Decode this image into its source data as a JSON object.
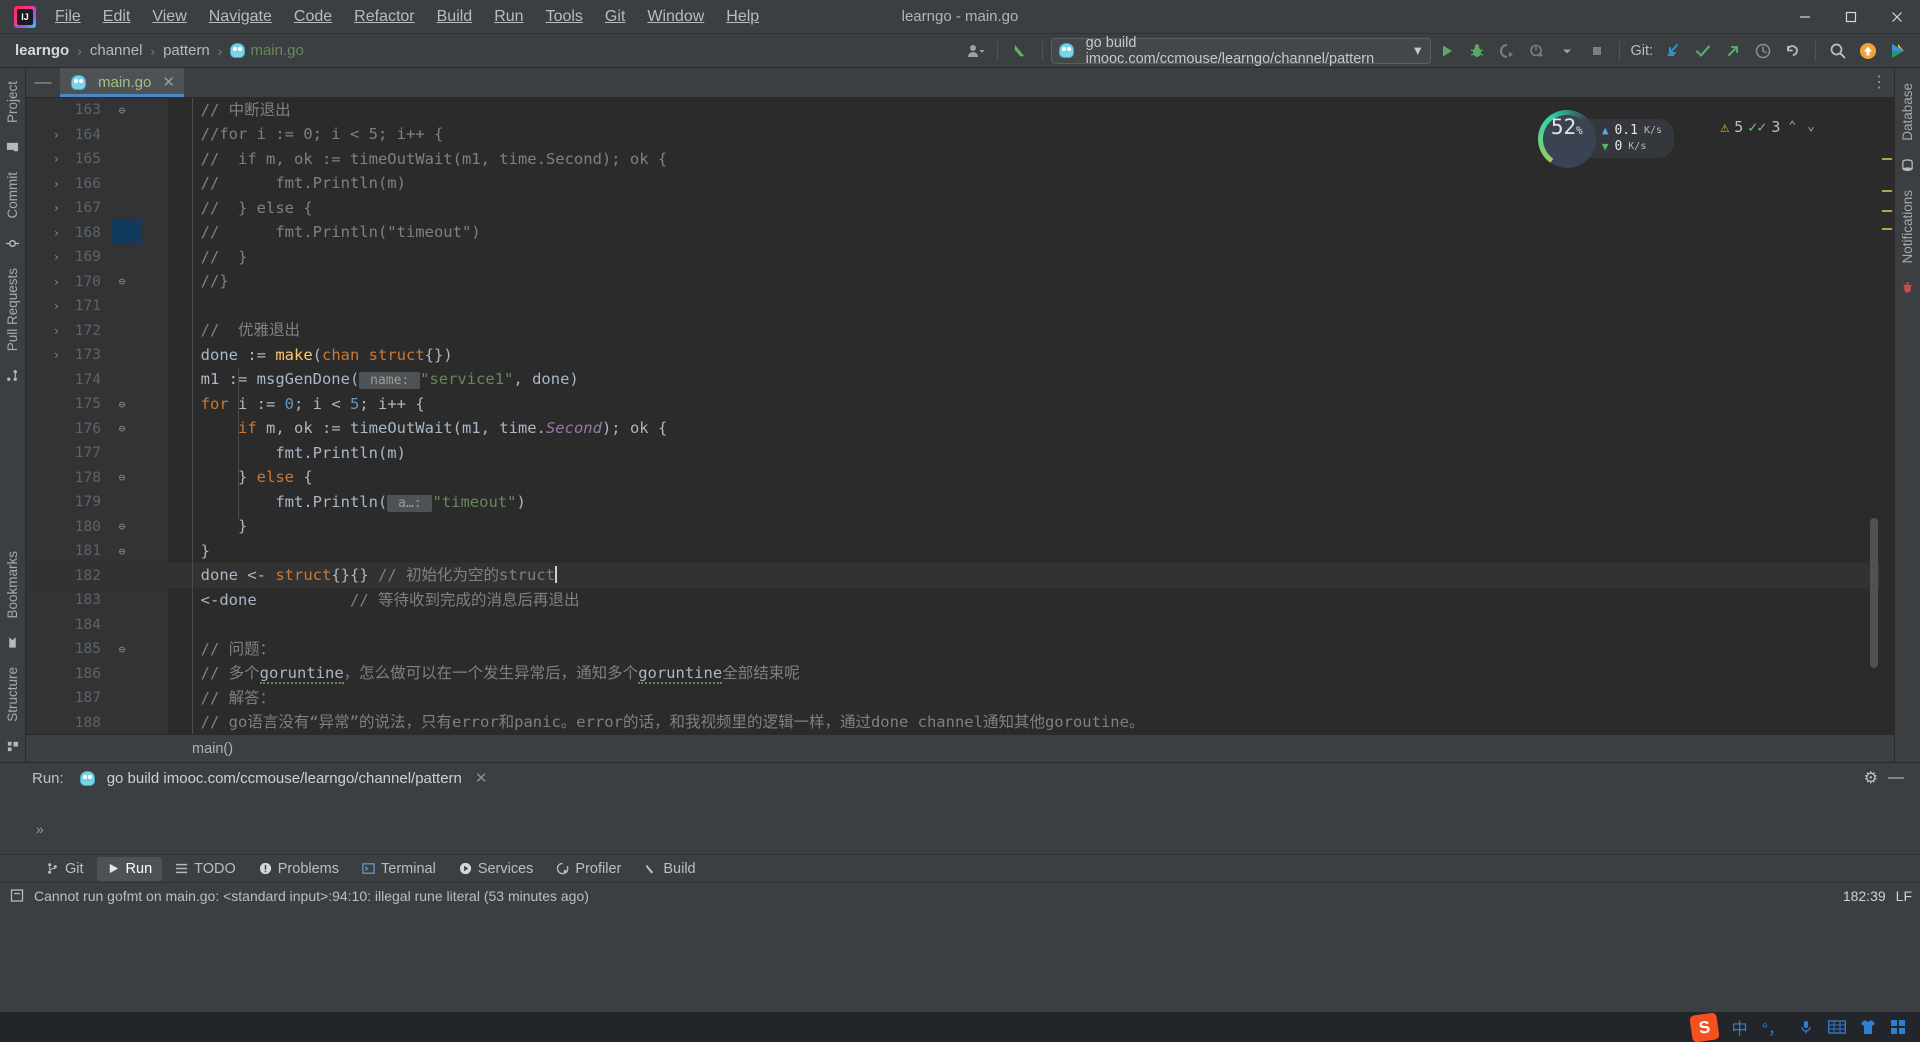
{
  "window": {
    "title": "learngo - main.go",
    "minimize": "—",
    "maximize": "☐",
    "close": "✕"
  },
  "menu": {
    "items": [
      "File",
      "Edit",
      "View",
      "Navigate",
      "Code",
      "Refactor",
      "Build",
      "Run",
      "Tools",
      "Git",
      "Window",
      "Help"
    ]
  },
  "breadcrumb": {
    "project": "learngo",
    "segments": [
      "channel",
      "pattern"
    ],
    "file": "main.go",
    "separator": "›"
  },
  "toolbar": {
    "run_config": "go build imooc.com/ccmouse/learngo/channel/pattern",
    "dropdown_caret": "▾",
    "git_label": "Git:",
    "buttons": {
      "run": "run-button",
      "debug": "debug-button",
      "coverage": "coverage-button",
      "profile": "profile-button",
      "more": "more-button",
      "stop": "stop-button",
      "update_project": "update-project-button",
      "commit": "commit-button",
      "push": "push-button",
      "history": "history-button",
      "rollback": "rollback-button",
      "search_everywhere": "search-everywhere-button"
    }
  },
  "sidebar_left": {
    "items": [
      "Project",
      "Commit",
      "Pull Requests",
      "Bookmarks",
      "Structure"
    ]
  },
  "sidebar_right": {
    "items": [
      "Database",
      "Notifications"
    ]
  },
  "editor": {
    "tab": {
      "name": "main.go",
      "close": "✕"
    },
    "collapse": "—",
    "gear": "⋮",
    "breadcrumb": "main()",
    "lines": [
      {
        "num": "163",
        "fold": "⊖",
        "segments": [
          {
            "t": "  // 中断退出",
            "c": "cmt"
          }
        ]
      },
      {
        "num": "164",
        "fold": "",
        "segments": [
          {
            "t": "  //for i := 0; i < 5; i++ {",
            "c": "cmt"
          }
        ]
      },
      {
        "num": "165",
        "fold": "",
        "segments": [
          {
            "t": "  //  if m, ok := timeOutWait(m1, time.Second); ok {",
            "c": "cmt"
          }
        ]
      },
      {
        "num": "166",
        "fold": "",
        "segments": [
          {
            "t": "  //      fmt.Println(m)",
            "c": "cmt"
          }
        ]
      },
      {
        "num": "167",
        "fold": "",
        "segments": [
          {
            "t": "  //  } else {",
            "c": "cmt"
          }
        ]
      },
      {
        "num": "168",
        "fold": "",
        "segments": [
          {
            "t": "  //      fmt.Println(\"timeout\")",
            "c": "cmt"
          }
        ]
      },
      {
        "num": "169",
        "fold": "",
        "segments": [
          {
            "t": "  //  }",
            "c": "cmt"
          }
        ]
      },
      {
        "num": "170",
        "fold": "⊖",
        "segments": [
          {
            "t": "  //}",
            "c": "cmt"
          }
        ]
      },
      {
        "num": "171",
        "fold": "",
        "segments": []
      },
      {
        "num": "172",
        "fold": "",
        "segments": [
          {
            "t": "  //  优雅退出",
            "c": "cmt"
          }
        ]
      },
      {
        "num": "173",
        "fold": "",
        "segments": [
          {
            "t": "  done := ",
            "c": "plain"
          },
          {
            "t": "make",
            "c": "fn"
          },
          {
            "t": "(",
            "c": "plain"
          },
          {
            "t": "chan struct",
            "c": "kw"
          },
          {
            "t": "{})",
            "c": "plain"
          }
        ]
      },
      {
        "num": "174",
        "fold": "",
        "segments": [
          {
            "t": "  m1 := msgGenDone(",
            "c": "plain"
          },
          {
            "t": " name: ",
            "c": "hintp"
          },
          {
            "t": "\"service1\"",
            "c": "str"
          },
          {
            "t": ", done)",
            "c": "plain"
          }
        ]
      },
      {
        "num": "175",
        "fold": "⊖",
        "segments": [
          {
            "t": "  ",
            "c": "plain"
          },
          {
            "t": "for",
            "c": "kw"
          },
          {
            "t": " i := ",
            "c": "plain"
          },
          {
            "t": "0",
            "c": "num"
          },
          {
            "t": "; i < ",
            "c": "plain"
          },
          {
            "t": "5",
            "c": "num"
          },
          {
            "t": "; i++ {",
            "c": "plain"
          }
        ]
      },
      {
        "num": "176",
        "fold": "⊖",
        "segments": [
          {
            "t": "      ",
            "c": "plain"
          },
          {
            "t": "if",
            "c": "kw"
          },
          {
            "t": " m, ok := timeOutWait(m1, time.",
            "c": "plain"
          },
          {
            "t": "Second",
            "c": "ital"
          },
          {
            "t": "); ok {",
            "c": "plain"
          }
        ]
      },
      {
        "num": "177",
        "fold": "",
        "segments": [
          {
            "t": "          fmt.Println(m)",
            "c": "plain"
          }
        ]
      },
      {
        "num": "178",
        "fold": "⊖",
        "segments": [
          {
            "t": "      } ",
            "c": "plain"
          },
          {
            "t": "else",
            "c": "kw"
          },
          {
            "t": " {",
            "c": "plain"
          }
        ]
      },
      {
        "num": "179",
        "fold": "",
        "segments": [
          {
            "t": "          fmt.Println(",
            "c": "plain"
          },
          {
            "t": " a…: ",
            "c": "hintp"
          },
          {
            "t": "\"timeout\"",
            "c": "str"
          },
          {
            "t": ")",
            "c": "plain"
          }
        ]
      },
      {
        "num": "180",
        "fold": "⊖",
        "segments": [
          {
            "t": "      }",
            "c": "plain"
          }
        ]
      },
      {
        "num": "181",
        "fold": "⊖",
        "segments": [
          {
            "t": "  }",
            "c": "plain"
          }
        ]
      },
      {
        "num": "182",
        "fold": "",
        "current": true,
        "segments": [
          {
            "t": "  done <- ",
            "c": "plain"
          },
          {
            "t": "struct",
            "c": "kw"
          },
          {
            "t": "{}{} ",
            "c": "plain"
          },
          {
            "t": "// 初始化为空的struct",
            "c": "cmt"
          },
          {
            "t": "▏",
            "c": "caret"
          }
        ]
      },
      {
        "num": "183",
        "fold": "",
        "segments": [
          {
            "t": "  <-done          ",
            "c": "plain"
          },
          {
            "t": "// 等待收到完成的消息后再退出",
            "c": "cmt"
          }
        ]
      },
      {
        "num": "184",
        "fold": "",
        "segments": []
      },
      {
        "num": "185",
        "fold": "⊖",
        "segments": [
          {
            "t": "  // 问题：",
            "c": "cmt"
          }
        ]
      },
      {
        "num": "186",
        "fold": "",
        "segments": [
          {
            "t": "  // 多个",
            "c": "cmt"
          },
          {
            "t": "goruntine",
            "c": "typo"
          },
          {
            "t": "，怎么做可以在一个发生异常后，通知多个",
            "c": "cmt"
          },
          {
            "t": "goruntine",
            "c": "typo"
          },
          {
            "t": "全部结束呢",
            "c": "cmt"
          }
        ]
      },
      {
        "num": "187",
        "fold": "",
        "segments": [
          {
            "t": "  // 解答：",
            "c": "cmt"
          }
        ]
      },
      {
        "num": "188",
        "fold": "",
        "segments": [
          {
            "t": "  // go语言没有“异常”的说法，只有error和panic。error的话，和我视频里的逻辑一样，通过done channel通知其他goroutine。",
            "c": "cmt"
          }
        ]
      }
    ]
  },
  "status_widgets": {
    "memory_percent": "52",
    "percent_sign": "%",
    "upload_value": "0.1",
    "upload_unit": "K/s",
    "download_value": "0",
    "download_unit": "K/s",
    "warning_count": "5",
    "ok_count": "3",
    "prev": "⌃",
    "next": "⌄"
  },
  "run_panel": {
    "label": "Run:",
    "tab": "go build imooc.com/ccmouse/learngo/channel/pattern",
    "tab_close": "✕",
    "settings": "⚙",
    "minimize": "—",
    "expand": "»"
  },
  "tool_windows": {
    "items": [
      {
        "label": "Git",
        "icon": "branch-icon",
        "active": false
      },
      {
        "label": "Run",
        "icon": "play-icon",
        "active": true
      },
      {
        "label": "TODO",
        "icon": "list-icon",
        "active": false
      },
      {
        "label": "Problems",
        "icon": "error-icon",
        "active": false
      },
      {
        "label": "Terminal",
        "icon": "terminal-icon",
        "active": false
      },
      {
        "label": "Services",
        "icon": "services-icon",
        "active": false
      },
      {
        "label": "Profiler",
        "icon": "profiler-icon",
        "active": false
      },
      {
        "label": "Build",
        "icon": "hammer-icon",
        "active": false
      }
    ]
  },
  "status_bar": {
    "message": "Cannot run gofmt on main.go: <standard input>:94:10: illegal rune literal (53 minutes ago)",
    "caret_position": "182:39",
    "line_separator": "LF"
  },
  "taskbar": {
    "ime_logo": "S",
    "ime_mode": "中",
    "punctuation": "°，",
    "icons": [
      "microphone-icon",
      "keyboard-icon",
      "skin-icon",
      "apps-icon"
    ]
  },
  "colors": {
    "bg_chrome": "#3c3f41",
    "bg_editor": "#2b2b2b",
    "bg_gutter": "#313335",
    "accent_blue": "#4a88c7",
    "keyword_orange": "#cc7832",
    "string_green": "#6a8759",
    "number_blue": "#6897bb",
    "comment_gray": "#808080",
    "function_yellow": "#ffc66d"
  }
}
